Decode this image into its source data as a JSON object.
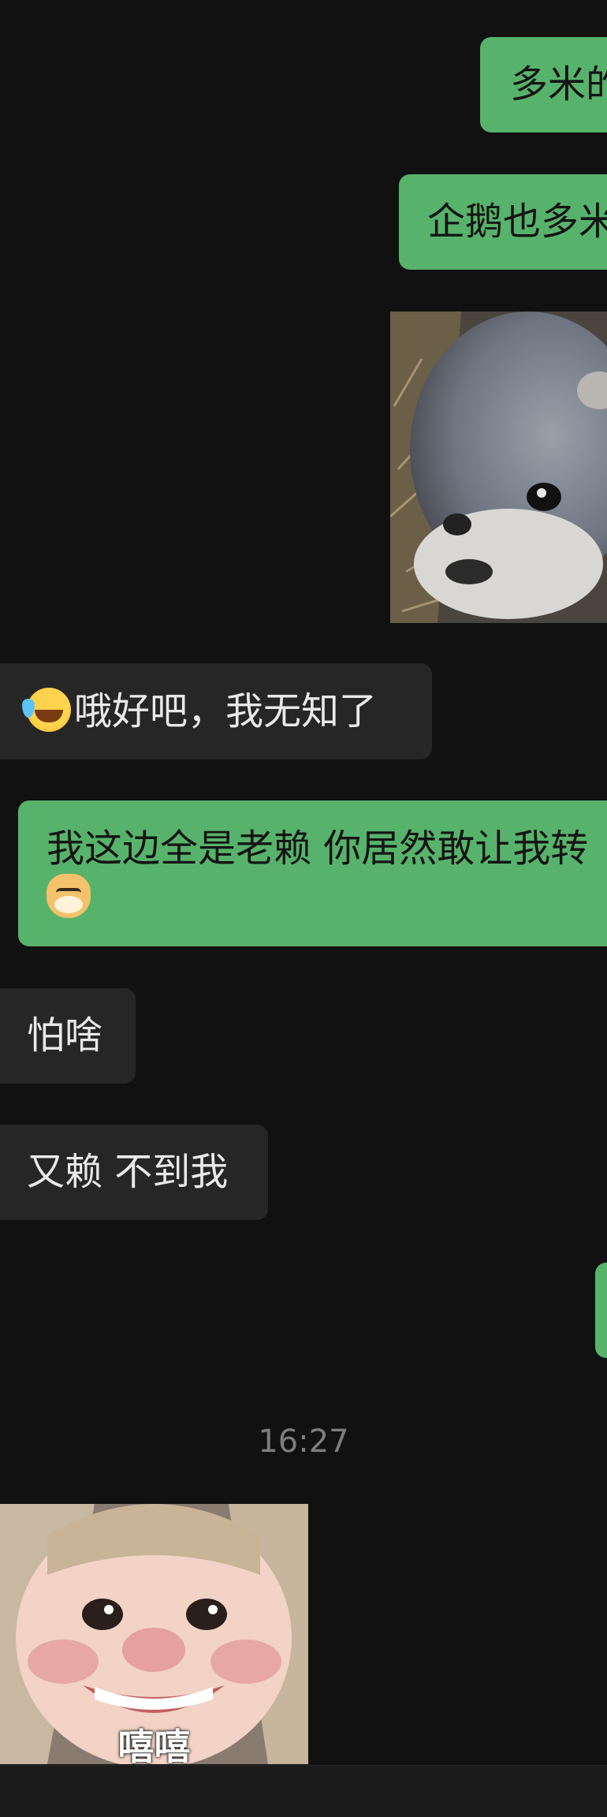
{
  "messages": {
    "m1": "多米的",
    "m2": "企鹅也多米",
    "m4_text": "哦好吧，我无知了",
    "m5_line1": "我这边全是老赖 你居然敢让我转",
    "m6": "怕啥",
    "m7": "又赖 不到我"
  },
  "timestamp": "16:27",
  "sticker": {
    "caption": "嘻嘻"
  },
  "icons": {
    "laugh_cry": "face-with-tears-of-joy-icon",
    "doge": "doge-icon"
  },
  "colors": {
    "background": "#111111",
    "outgoing_bubble": "#57b36b",
    "incoming_bubble": "#262626"
  }
}
